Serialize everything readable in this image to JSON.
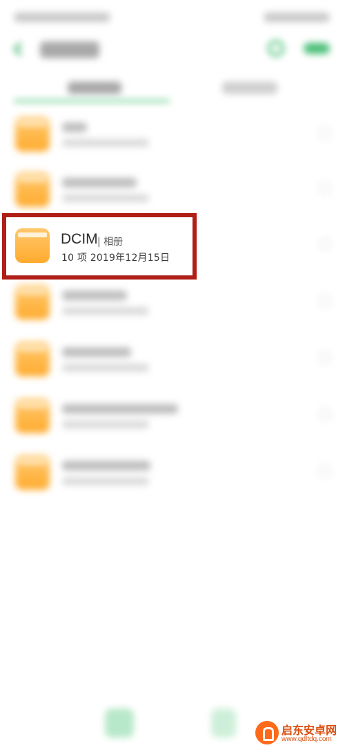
{
  "highlighted_item": {
    "name": "DCIM",
    "alias": "| 相册",
    "meta": "10 项  2019年12月15日"
  },
  "watermark": {
    "title": "启东安卓网",
    "url": "www.qdltdq.com"
  },
  "icons": {
    "back": "chevron-left-icon",
    "search": "search-icon",
    "folder": "folder-icon",
    "more": "more-icon",
    "logo": "rocket-logo-icon"
  },
  "colors": {
    "accent": "#4cbf78",
    "folder": "#ffab2e",
    "highlight_frame": "#b01f17",
    "watermark": "#d94d0f"
  }
}
